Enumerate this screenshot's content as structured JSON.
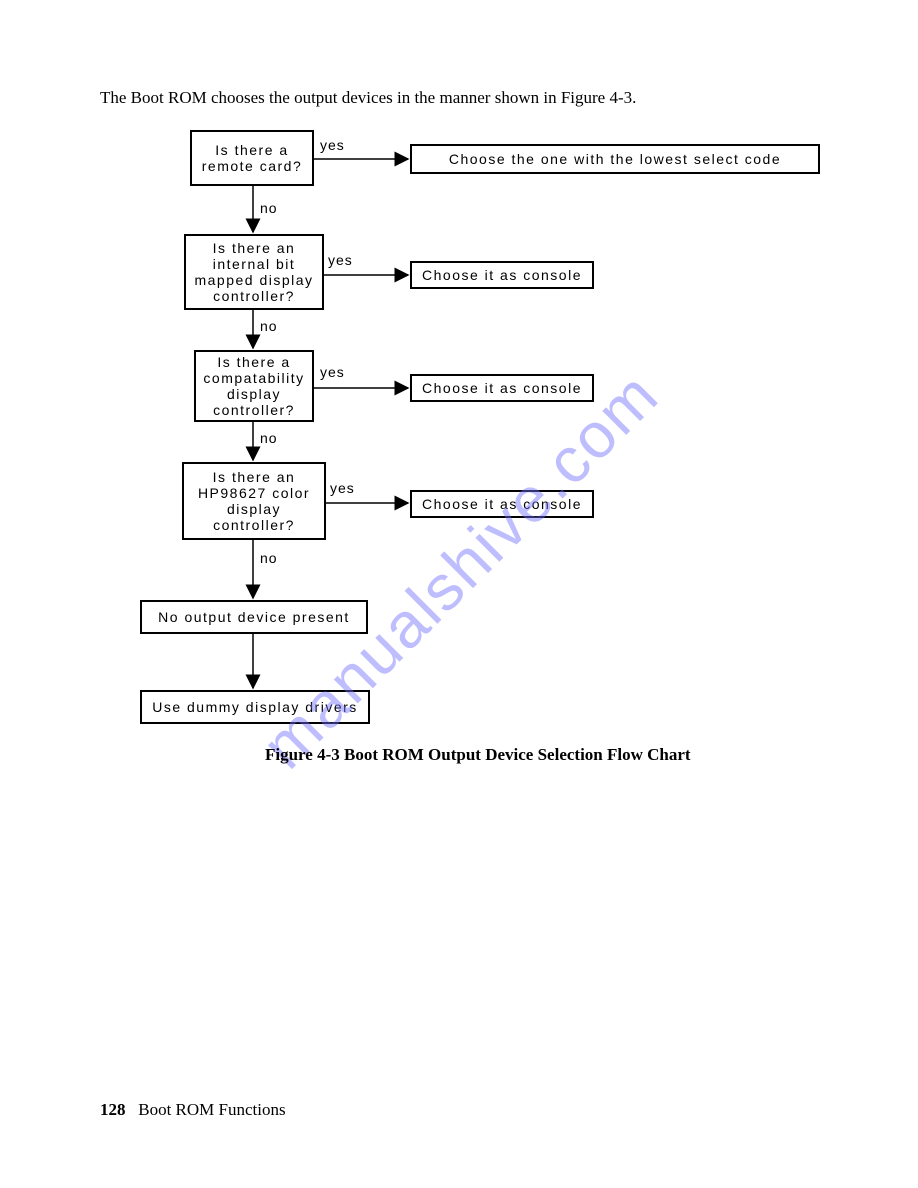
{
  "intro": "The Boot ROM chooses the output devices in the manner shown in Figure 4-3.",
  "flow": {
    "q1": "Is  there  a\nremote  card?",
    "a1": "Choose  the  one  with  the  lowest  select  code",
    "q2": "Is  there  an\ninternal  bit\nmapped  display\ncontroller?",
    "a2": "Choose  it  as  console",
    "q3": "Is  there  a\ncompatability\ndisplay\ncontroller?",
    "a3": "Choose  it  as  console",
    "q4": "Is  there  an\nHP98627  color\ndisplay\ncontroller?",
    "a4": "Choose  it  as  console",
    "b5": "No  output  device  present",
    "b6": "Use  dummy  display  drivers",
    "yes": "yes",
    "no": "no"
  },
  "caption": "Figure 4-3 Boot ROM Output Device Selection Flow Chart",
  "footer": {
    "page": "128",
    "section": "Boot ROM Functions"
  },
  "watermark": "manualshive.com"
}
